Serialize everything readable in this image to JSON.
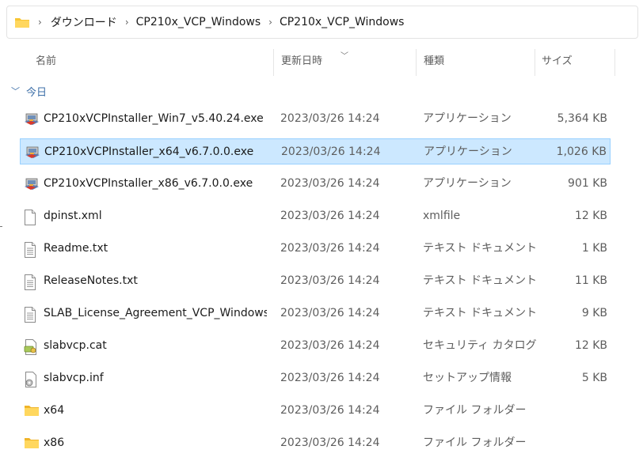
{
  "breadcrumb": {
    "items": [
      "ダウンロード",
      "CP210x_VCP_Windows",
      "CP210x_VCP_Windows"
    ]
  },
  "columns": {
    "name": "名前",
    "date": "更新日時",
    "type": "種類",
    "size": "サイズ"
  },
  "group": {
    "label": "今日"
  },
  "files": [
    {
      "name": "CP210xVCPInstaller_Win7_v5.40.24.exe",
      "date": "2023/03/26 14:24",
      "type": "アプリケーション",
      "size": "5,364 KB",
      "icon": "installer-icon"
    },
    {
      "name": "CP210xVCPInstaller_x64_v6.7.0.0.exe",
      "date": "2023/03/26 14:24",
      "type": "アプリケーション",
      "size": "1,026 KB",
      "icon": "installer-icon"
    },
    {
      "name": "CP210xVCPInstaller_x86_v6.7.0.0.exe",
      "date": "2023/03/26 14:24",
      "type": "アプリケーション",
      "size": "901 KB",
      "icon": "installer-icon"
    },
    {
      "name": "dpinst.xml",
      "date": "2023/03/26 14:24",
      "type": "xmlfile",
      "size": "12 KB",
      "icon": "blank-file-icon"
    },
    {
      "name": "Readme.txt",
      "date": "2023/03/26 14:24",
      "type": "テキスト ドキュメント",
      "size": "1 KB",
      "icon": "text-file-icon"
    },
    {
      "name": "ReleaseNotes.txt",
      "date": "2023/03/26 14:24",
      "type": "テキスト ドキュメント",
      "size": "11 KB",
      "icon": "text-file-icon"
    },
    {
      "name": "SLAB_License_Agreement_VCP_Windows....",
      "date": "2023/03/26 14:24",
      "type": "テキスト ドキュメント",
      "size": "9 KB",
      "icon": "text-file-icon"
    },
    {
      "name": "slabvcp.cat",
      "date": "2023/03/26 14:24",
      "type": "セキュリティ カタログ",
      "size": "12 KB",
      "icon": "catalog-file-icon"
    },
    {
      "name": "slabvcp.inf",
      "date": "2023/03/26 14:24",
      "type": "セットアップ情報",
      "size": "5 KB",
      "icon": "setup-info-icon"
    },
    {
      "name": "x64",
      "date": "2023/03/26 14:24",
      "type": "ファイル フォルダー",
      "size": "",
      "icon": "folder-icon"
    },
    {
      "name": "x86",
      "date": "2023/03/26 14:24",
      "type": "ファイル フォルダー",
      "size": "",
      "icon": "folder-icon"
    }
  ],
  "selected_index": 1,
  "colors": {
    "selection_fill": "#cce8ff",
    "selection_border": "#99d1ff",
    "folder_yellow": "#f8c534",
    "group_blue": "#3d6fa8"
  }
}
